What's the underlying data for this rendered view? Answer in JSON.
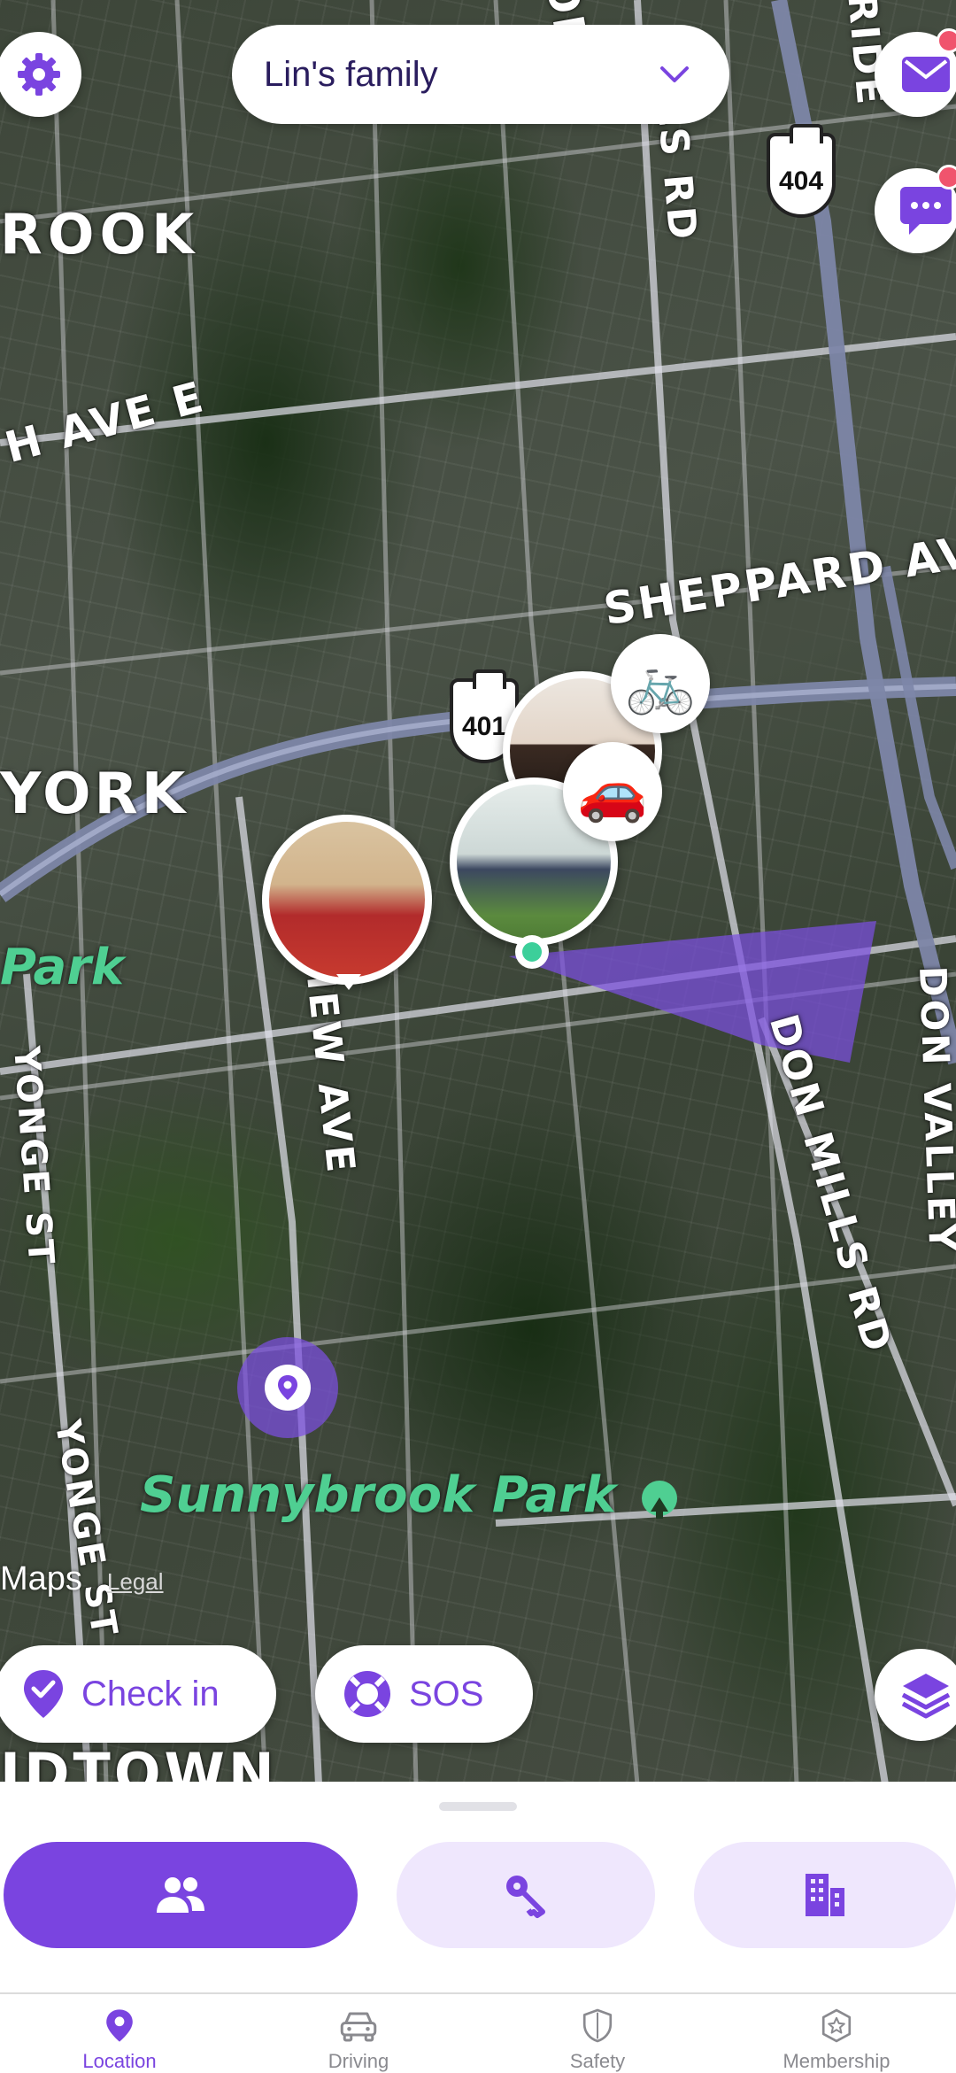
{
  "header": {
    "circle_name": "Lin's family",
    "settings_icon": "gear-icon",
    "dropdown_icon": "chevron-down-icon",
    "messages_icon": "mail-icon",
    "chat_icon": "chat-bubble-icon"
  },
  "map": {
    "street_labels": {
      "e_ave": "H AVE E",
      "rook": "ROOK",
      "sheppard": "SHEPPARD AVE",
      "york": "YORK",
      "bayview": "BAYVIEW AVE",
      "yonge_upper": "YONGE ST",
      "yonge_lower": "YONGE ST",
      "don_mills_top": "LLS RD",
      "don_mills": "DON MILLS RD",
      "don_valley": "DON VALLEY",
      "midtown": "IDTOWN",
      "top_right": "RIDE",
      "top_fragment": "ON"
    },
    "park_labels": {
      "park_left": "Park",
      "sunnybrook": "Sunnybrook Park"
    },
    "highways": {
      "hwy_401": "401",
      "hwy_404": "404"
    },
    "attribution": {
      "brand": "Maps",
      "legal": "Legal"
    },
    "colors": {
      "accent": "#7a44e0",
      "zone": "#7b4fe0",
      "park_text": "#4fcf92"
    }
  },
  "actions": {
    "check_in": "Check in",
    "sos": "SOS",
    "check_in_icon": "pin-check-icon",
    "sos_icon": "lifebuoy-icon",
    "layers_icon": "layers-icon"
  },
  "sheet": {
    "segments": [
      {
        "icon": "people-icon",
        "active": true
      },
      {
        "icon": "keys-icon",
        "active": false
      },
      {
        "icon": "building-icon",
        "active": false
      }
    ]
  },
  "tabs": [
    {
      "label": "Location",
      "icon": "location-pin-icon",
      "active": true
    },
    {
      "label": "Driving",
      "icon": "car-icon",
      "active": false
    },
    {
      "label": "Safety",
      "icon": "shield-icon",
      "active": false
    },
    {
      "label": "Membership",
      "icon": "star-badge-icon",
      "active": false
    }
  ]
}
